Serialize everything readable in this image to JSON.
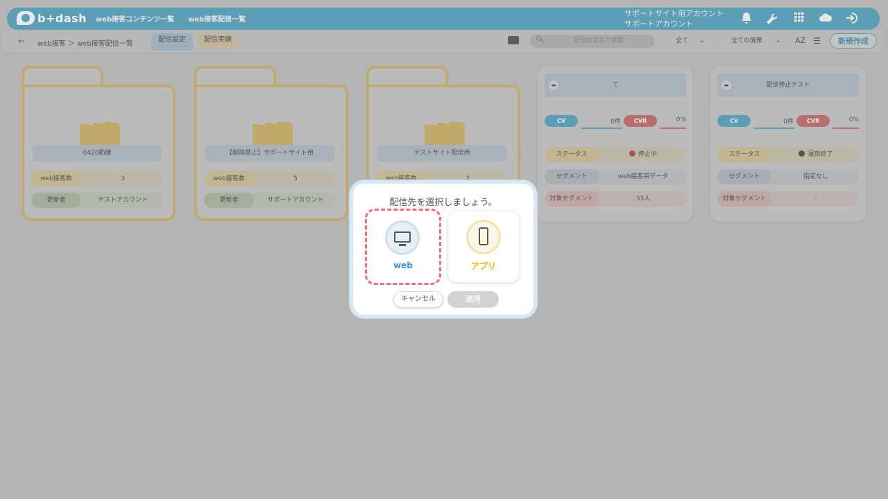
{
  "header": {
    "logo_text": "b+dash",
    "nav": [
      "web接客コンテンツ一覧",
      "web接客配信一覧"
    ],
    "account_line1": "サポートサイト用アカウント",
    "account_line2": "サポートアカウント",
    "icons": [
      "bell-icon",
      "wrench-icon",
      "grid-icon",
      "cloud-icon",
      "logout-icon"
    ],
    "brand_color": "#5c9eb6"
  },
  "toolbar": {
    "breadcrumb": "web接客 ＞ web接客配信一覧",
    "tabs": [
      "配信設定",
      "配信実績"
    ],
    "search_placeholder": "配信設定名で検索",
    "filter1": "全て",
    "filter2": "全ての施策",
    "new_button": "新規作成"
  },
  "folders": [
    {
      "title": "0420動確",
      "rows": [
        {
          "label": "web接客数",
          "value": "3"
        },
        {
          "label": "更新者",
          "value": "テストアカウント"
        }
      ]
    },
    {
      "title": "【削除禁止】サポートサイト用",
      "rows": [
        {
          "label": "web接客数",
          "value": "5"
        },
        {
          "label": "更新者",
          "value": "サポートアカウント"
        }
      ]
    },
    {
      "title": "テストサイト配信用",
      "rows": [
        {
          "label": "web接客数",
          "value": "2"
        }
      ]
    }
  ],
  "cards": [
    {
      "title": "て",
      "cv_label": "CV",
      "cv_value": "0件",
      "cvr_label": "CVR",
      "cvr_value": "0%",
      "status_label": "ステータス",
      "status_value": "停止中",
      "segment_label": "セグメント",
      "segment_value": "web接客用データ",
      "target_label": "対象セグメント",
      "target_value": "33人"
    },
    {
      "title": "配信停止テスト",
      "cv_label": "CV",
      "cv_value": "0件",
      "cvr_label": "CVR",
      "cvr_value": "0%",
      "status_label": "ステータス",
      "status_value": "運用終了",
      "segment_label": "セグメント",
      "segment_value": "指定なし",
      "target_label": "対象セグメント",
      "target_value": "-"
    }
  ],
  "modal": {
    "title": "配信先を選択しましょう。",
    "options": [
      {
        "label": "web",
        "icon": "monitor-icon",
        "color": "#3d8fd6",
        "selected": true
      },
      {
        "label": "アプリ",
        "icon": "smartphone-icon",
        "color": "#f0b400",
        "selected": false
      }
    ],
    "cancel": "キャンセル",
    "apply": "適用"
  }
}
